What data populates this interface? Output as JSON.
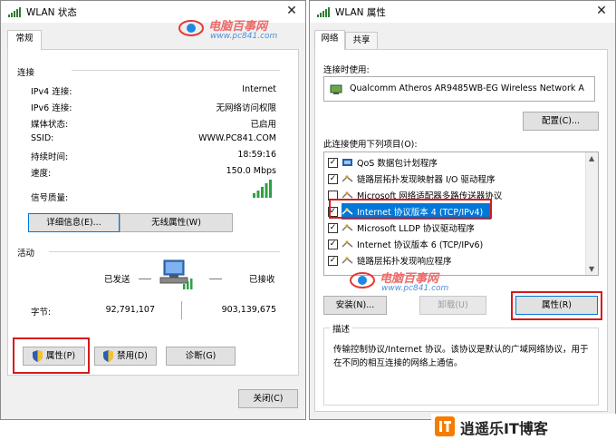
{
  "left_dialog": {
    "title": "WLAN 状态",
    "tab_general": "常规",
    "connection_header": "连接",
    "rows": [
      {
        "label": "IPv4 连接:",
        "value": "Internet"
      },
      {
        "label": "IPv6 连接:",
        "value": "无网络访问权限"
      },
      {
        "label": "媒体状态:",
        "value": "已启用"
      },
      {
        "label": "SSID:",
        "value": "WWW.PC841.COM"
      },
      {
        "label": "持续时间:",
        "value": "18:59:16"
      },
      {
        "label": "速度:",
        "value": "150.0 Mbps"
      }
    ],
    "signal_label": "信号质量:",
    "details_button": "详细信息(E)...",
    "wireless_props_button": "无线属性(W)",
    "activity_header": "活动",
    "sent_label": "已发送",
    "received_label": "已接收",
    "bytes_label": "字节:",
    "bytes_sent": "92,791,107",
    "bytes_received": "903,139,675",
    "properties_button": "属性(P)",
    "disable_button": "禁用(D)",
    "diagnose_button": "诊断(G)",
    "close_button": "关闭(C)"
  },
  "right_dialog": {
    "title": "WLAN 属性",
    "tab_network": "网络",
    "tab_sharing": "共享",
    "connect_using_label": "连接时使用:",
    "adapter_name": "Qualcomm Atheros AR9485WB-EG Wireless Network A",
    "configure_button": "配置(C)...",
    "items_label": "此连接使用下列项目(O):",
    "items": [
      {
        "label": "QoS 数据包计划程序",
        "checked": true
      },
      {
        "label": "链路层拓扑发现映射器 I/O 驱动程序",
        "checked": true
      },
      {
        "label": "Microsoft 网络适配器多路传送器协议",
        "checked": false
      },
      {
        "label": "Internet 协议版本 4 (TCP/IPv4)",
        "checked": true,
        "selected": true
      },
      {
        "label": "Microsoft LLDP 协议驱动程序",
        "checked": true
      },
      {
        "label": "Internet 协议版本 6 (TCP/IPv6)",
        "checked": true
      },
      {
        "label": "链路层拓扑发现响应程序",
        "checked": true
      }
    ],
    "install_button": "安装(N)...",
    "uninstall_button": "卸载(U)",
    "properties_button": "属性(R)",
    "description_header": "描述",
    "description_text": "传输控制协议/Internet 协议。该协议是默认的广域网络协议，用于在不同的相互连接的网络上通信。"
  },
  "watermarks": {
    "site_name": "电脑百事网",
    "site_url": "www.pc841.com",
    "bottom_brand": "逍遥乐IT博客"
  },
  "colors": {
    "highlight_red": "#d7191c",
    "selection_blue": "#0078d7",
    "signal_green": "#2ea043"
  }
}
